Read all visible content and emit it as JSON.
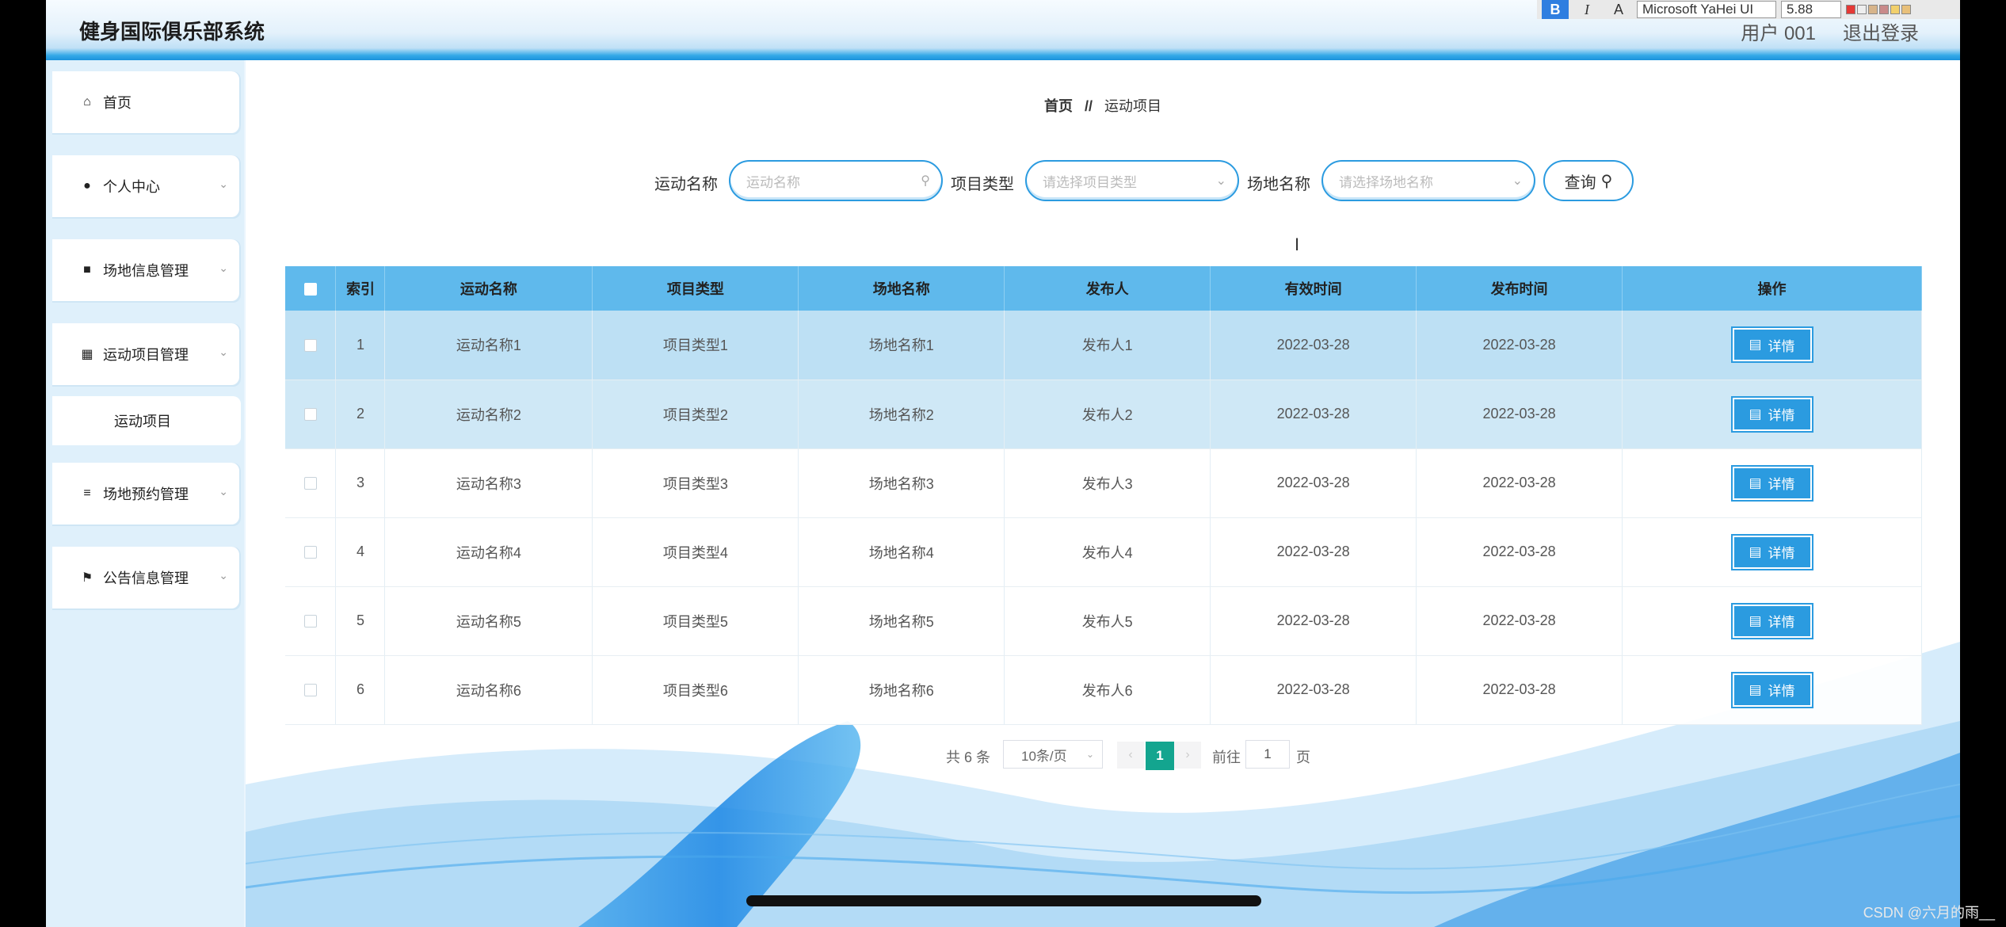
{
  "app": {
    "title": "健身国际俱乐部系统"
  },
  "user": {
    "name": "用户 001",
    "logout": "退出登录"
  },
  "toolbar": {
    "bold": "B",
    "italic": "I",
    "font": "Microsoft YaHei UI",
    "size": "5.88"
  },
  "sidebar": {
    "items": [
      {
        "label": "首页",
        "icon": "home-icon"
      },
      {
        "label": "个人中心",
        "icon": "user-icon"
      },
      {
        "label": "场地信息管理",
        "icon": "monitor-icon"
      },
      {
        "label": "运动项目管理",
        "icon": "grid-icon"
      },
      {
        "label": "场地预约管理",
        "icon": "sliders-icon"
      },
      {
        "label": "公告信息管理",
        "icon": "flag-icon"
      }
    ],
    "sub_item": "运动项目"
  },
  "breadcrumb": {
    "home": "首页",
    "separator": "//",
    "current": "运动项目"
  },
  "search": {
    "name_label": "运动名称",
    "name_placeholder": "运动名称",
    "type_label": "项目类型",
    "type_placeholder": "请选择项目类型",
    "venue_label": "场地名称",
    "venue_placeholder": "请选择场地名称",
    "query_label": "查询"
  },
  "table": {
    "headers": [
      "索引",
      "运动名称",
      "项目类型",
      "场地名称",
      "发布人",
      "有效时间",
      "发布时间",
      "操作"
    ],
    "detail_label": "详情",
    "rows": [
      {
        "index": "1",
        "name": "运动名称1",
        "type": "项目类型1",
        "venue": "场地名称1",
        "publisher": "发布人1",
        "valid": "2022-03-28",
        "published": "2022-03-28"
      },
      {
        "index": "2",
        "name": "运动名称2",
        "type": "项目类型2",
        "venue": "场地名称2",
        "publisher": "发布人2",
        "valid": "2022-03-28",
        "published": "2022-03-28"
      },
      {
        "index": "3",
        "name": "运动名称3",
        "type": "项目类型3",
        "venue": "场地名称3",
        "publisher": "发布人3",
        "valid": "2022-03-28",
        "published": "2022-03-28"
      },
      {
        "index": "4",
        "name": "运动名称4",
        "type": "项目类型4",
        "venue": "场地名称4",
        "publisher": "发布人4",
        "valid": "2022-03-28",
        "published": "2022-03-28"
      },
      {
        "index": "5",
        "name": "运动名称5",
        "type": "项目类型5",
        "venue": "场地名称5",
        "publisher": "发布人5",
        "valid": "2022-03-28",
        "published": "2022-03-28"
      },
      {
        "index": "6",
        "name": "运动名称6",
        "type": "项目类型6",
        "venue": "场地名称6",
        "publisher": "发布人6",
        "valid": "2022-03-28",
        "published": "2022-03-28"
      }
    ]
  },
  "pager": {
    "total": "共 6 条",
    "page_size": "10条/页",
    "current_page": "1",
    "goto": "前往",
    "goto_value": "1",
    "unit": "页"
  },
  "watermark": "CSDN @六月的雨__",
  "colors": {
    "accent": "#2b9be0",
    "header_th": "#5fb9ec",
    "page_active": "#13a58f"
  }
}
